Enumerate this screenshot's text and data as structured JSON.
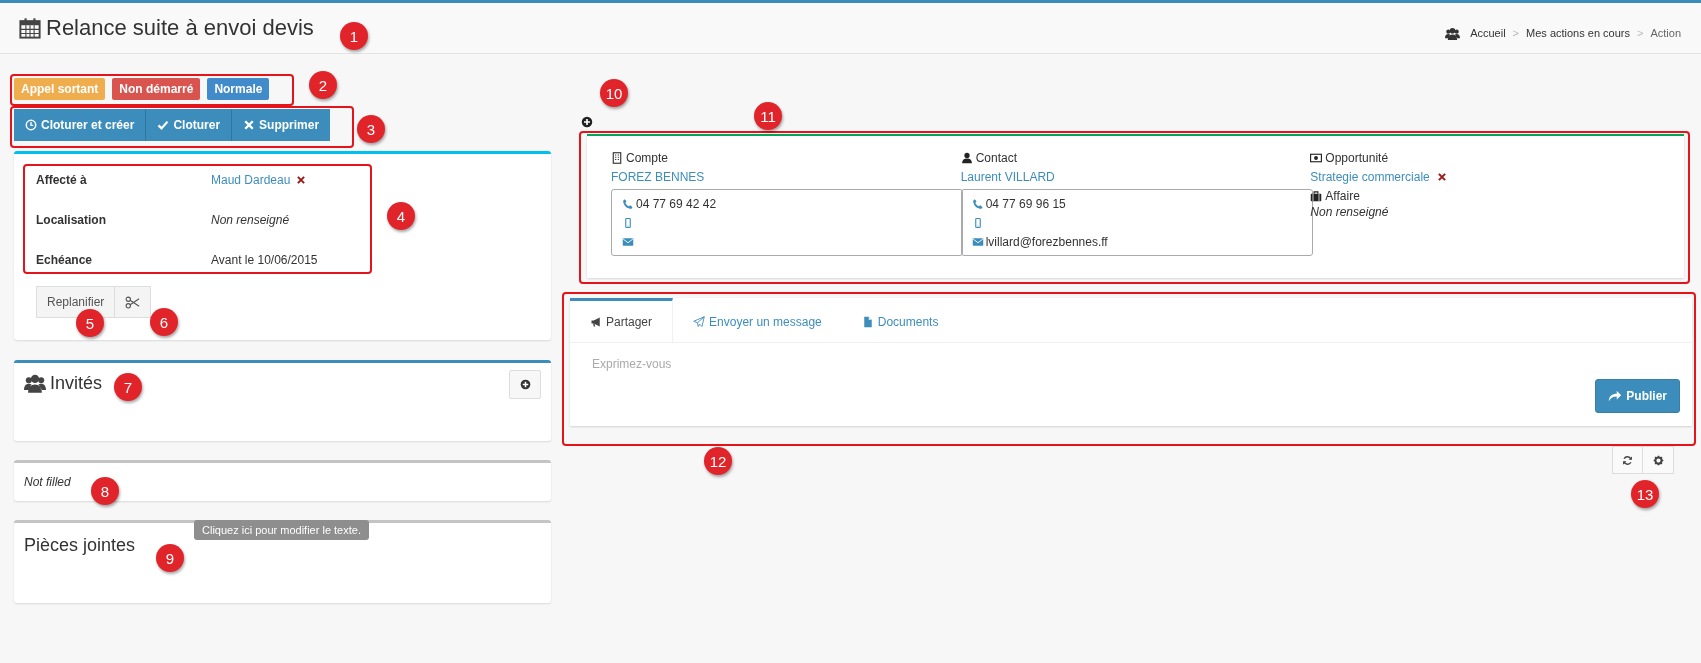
{
  "header": {
    "title": "Relance suite à envoi devis",
    "breadcrumb": [
      "Accueil",
      "Mes actions en cours",
      "Action"
    ],
    "separator": ">"
  },
  "labels": [
    {
      "text": "Appel sortant",
      "color": "#f0ad4e"
    },
    {
      "text": "Non démarré",
      "color": "#d9534f"
    },
    {
      "text": "Normale",
      "color": "#428bca"
    }
  ],
  "actions": [
    {
      "label": "Cloturer et créer"
    },
    {
      "label": "Cloturer"
    },
    {
      "label": "Supprimer"
    }
  ],
  "details": [
    {
      "label": "Affecté à",
      "value": "Maud Dardeau",
      "kind": "link",
      "removable": true
    },
    {
      "label": "Localisation",
      "value": "Non renseigné",
      "kind": "empty",
      "removable": false
    },
    {
      "label": "Echéance",
      "value": "Avant le 10/06/2015",
      "kind": "text",
      "removable": false
    }
  ],
  "replan_button": "Replanifier",
  "guests": {
    "title": "Invités"
  },
  "note": {
    "text": "Not filled",
    "tooltip": "Cliquez ici pour modifier le texte."
  },
  "attachments": {
    "title": "Pièces jointes"
  },
  "relations": [
    {
      "kind": "contact",
      "heading": "Compte",
      "name": "FOREZ BENNES",
      "removable": false,
      "phone": "04 77 69 42 42"
    },
    {
      "kind": "contact",
      "heading": "Contact",
      "name": "Laurent VILLARD",
      "removable": false,
      "phone": "04 77 69 96 15",
      "email": "lvillard@forezbennes.ff"
    },
    {
      "kind": "opportunity",
      "heading": "Opportunité",
      "name": "Strategie commerciale",
      "removable": true,
      "sub_heading": "Affaire",
      "sub_value": "Non renseigné"
    }
  ],
  "composer": {
    "tabs": [
      {
        "label": "Partager",
        "selected": true
      },
      {
        "label": "Envoyer un message",
        "selected": false
      },
      {
        "label": "Documents",
        "selected": false
      }
    ],
    "placeholder": "Exprimez-vous",
    "submit": "Publier"
  },
  "callouts": [
    "1",
    "2",
    "3",
    "4",
    "5",
    "6",
    "7",
    "8",
    "9",
    "10",
    "11",
    "12",
    "13"
  ]
}
